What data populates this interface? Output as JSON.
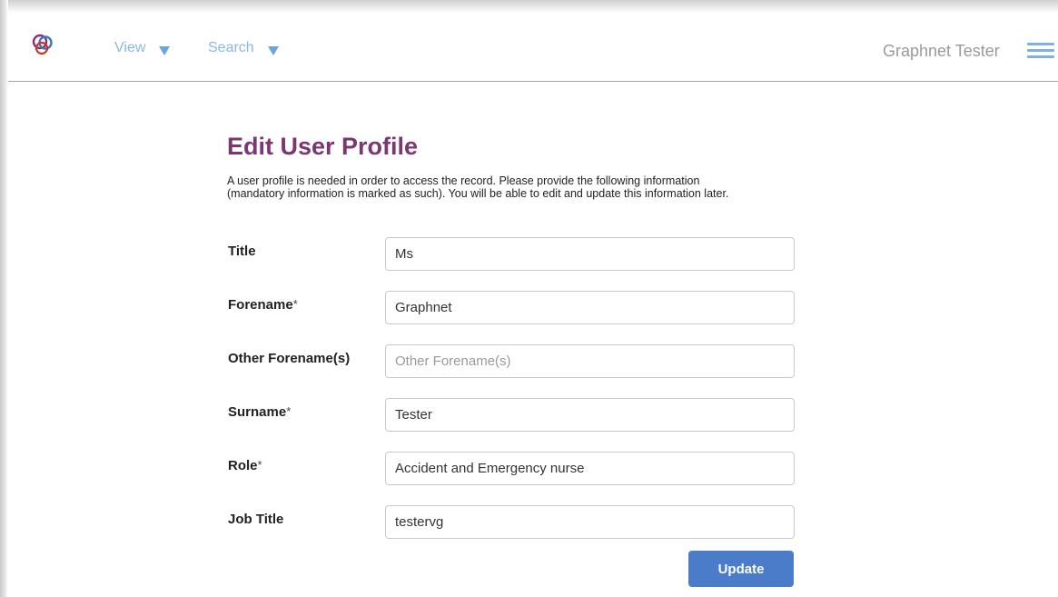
{
  "header": {
    "nav": [
      {
        "label": "View"
      },
      {
        "label": "Search"
      }
    ],
    "user_name": "Graphnet Tester"
  },
  "page": {
    "title": "Edit User Profile",
    "intro_line1": "A user profile is needed in order to access the record. Please provide the following information",
    "intro_line2": "(mandatory information is marked as such). You will be able to edit and update this information later."
  },
  "form": {
    "required_marker": "*",
    "fields": [
      {
        "label": "Title",
        "value": "Ms",
        "placeholder": "",
        "required": false
      },
      {
        "label": "Forename",
        "value": "Graphnet",
        "placeholder": "",
        "required": true
      },
      {
        "label": "Other Forename(s)",
        "value": "",
        "placeholder": "Other Forename(s)",
        "required": false
      },
      {
        "label": "Surname",
        "value": "Tester",
        "placeholder": "",
        "required": true
      },
      {
        "label": "Role",
        "value": "Accident and Emergency nurse",
        "placeholder": "",
        "required": true
      },
      {
        "label": "Job Title",
        "value": "testervg",
        "placeholder": "",
        "required": false
      }
    ],
    "update_label": "Update"
  },
  "colors": {
    "title": "#7a3773",
    "nav": "#8ab8e6",
    "button": "#4a7cc9"
  },
  "icons": {
    "logo": "graphnet-logo-icon",
    "menu": "hamburger-menu-icon",
    "caret": "caret-down-icon"
  }
}
